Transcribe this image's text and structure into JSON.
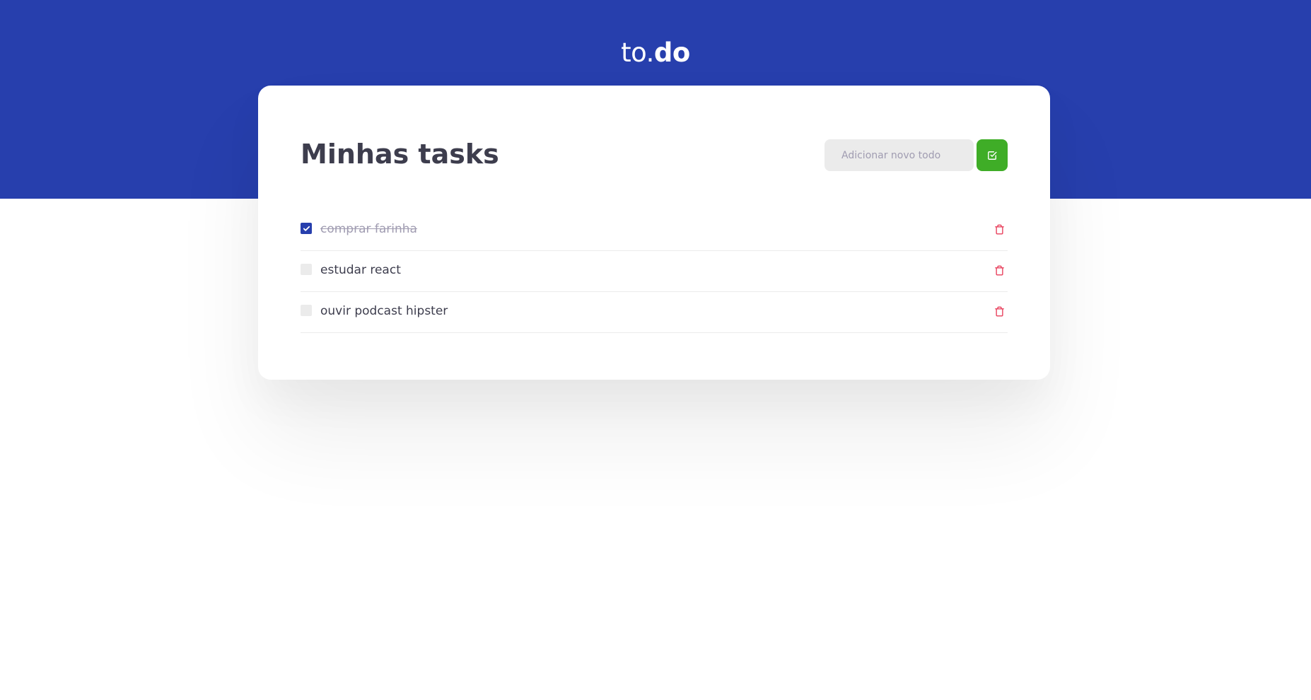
{
  "app": {
    "logo_prefix": "to.",
    "logo_bold": "do"
  },
  "colors": {
    "brand_blue": "#273fad",
    "add_green": "#3fad27",
    "delete_red": "#e83f5b",
    "text_dark": "#3d3d4d",
    "input_bg": "#ebebeb"
  },
  "main": {
    "title": "Minhas tasks",
    "new_todo": {
      "placeholder": "Adicionar novo todo",
      "value": "",
      "add_button_icon": "check-square-icon"
    }
  },
  "tasks": [
    {
      "title": "comprar farinha",
      "completed": true,
      "delete_icon": "trash-icon"
    },
    {
      "title": "estudar react",
      "completed": false,
      "delete_icon": "trash-icon"
    },
    {
      "title": "ouvir podcast hipster",
      "completed": false,
      "delete_icon": "trash-icon"
    }
  ]
}
